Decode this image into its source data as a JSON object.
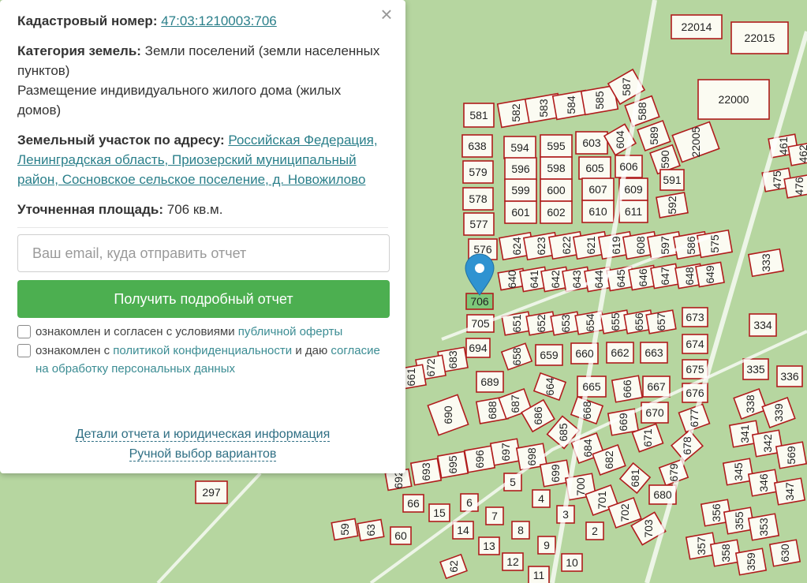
{
  "panel": {
    "close_symbol": "×",
    "cadastral": {
      "label": "Кадастровый номер:",
      "value": "47:03:1210003:706"
    },
    "category": {
      "label": "Категория земель:",
      "value": "Земли поселений (земли населенных пунктов)",
      "use": "Размещение индивидуального жилого дома (жилых домов)"
    },
    "address": {
      "label": "Земельный участок по адресу:",
      "value": "Российская Федерация, Ленинградская область, Приозерский муниципальный район, Сосновское сельское поселение, д. Новожилово"
    },
    "area": {
      "label": "Уточненная площадь:",
      "value": "706 кв.м."
    },
    "email_placeholder": "Ваш email, куда отправить отчет",
    "submit_label": "Получить подробный отчет",
    "consent1": {
      "text": "ознакомлен и согласен с условиями",
      "link": "публичной оферты"
    },
    "consent2": {
      "text1": "ознакомлен с",
      "link1": "политикой конфиденциальности",
      "text2": "и даю",
      "link2": "согласие на обработку персональных данных"
    },
    "details_link": "Детали отчета и юридическая информация",
    "manual_link": "Ручной выбор вариантов"
  },
  "map": {
    "colors": {
      "background": "#b6d6a0",
      "plot_fill": "#fbfbf2",
      "border": "#b01c1c",
      "road": "#ffffff",
      "selected": "#7ec87a",
      "marker": "#2f93d1"
    },
    "icons": {
      "marker": "map-pin-icon",
      "close": "close-icon"
    },
    "selected_plot": "706",
    "plots": [
      "22014",
      "22015",
      "22000",
      "581",
      "582",
      "583",
      "584",
      "585",
      "587",
      "588",
      "589",
      "590",
      "22005",
      "638",
      "594",
      "595",
      "603",
      "604",
      "579",
      "596",
      "598",
      "605",
      "606",
      "578",
      "599",
      "600",
      "607",
      "609",
      "591",
      "577",
      "601",
      "602",
      "610",
      "611",
      "592",
      "576",
      "624",
      "623",
      "622",
      "621",
      "619",
      "608",
      "597",
      "586",
      "575",
      "640",
      "641",
      "642",
      "643",
      "644",
      "645",
      "646",
      "647",
      "648",
      "649",
      "706",
      "705",
      "651",
      "652",
      "653",
      "654",
      "655",
      "656",
      "657",
      "673",
      "694",
      "683",
      "672",
      "661",
      "658",
      "659",
      "660",
      "662",
      "663",
      "674",
      "689",
      "664",
      "665",
      "666",
      "667",
      "675",
      "676",
      "690",
      "688",
      "687",
      "686",
      "668",
      "670",
      "677",
      "669",
      "685",
      "671",
      "678",
      "684",
      "682",
      "681",
      "679",
      "680",
      "693",
      "695",
      "696",
      "697",
      "698",
      "699",
      "700",
      "701",
      "702",
      "703",
      "692",
      "66",
      "5",
      "4",
      "3",
      "2",
      "15",
      "6",
      "7",
      "8",
      "14",
      "13",
      "9",
      "12",
      "11",
      "10",
      "62",
      "59",
      "63",
      "60",
      "297",
      "333",
      "334",
      "335",
      "336",
      "338",
      "339",
      "341",
      "342",
      "569",
      "345",
      "346",
      "347",
      "356",
      "355",
      "353",
      "357",
      "358",
      "359",
      "630",
      "461",
      "462",
      "475",
      "476"
    ]
  }
}
